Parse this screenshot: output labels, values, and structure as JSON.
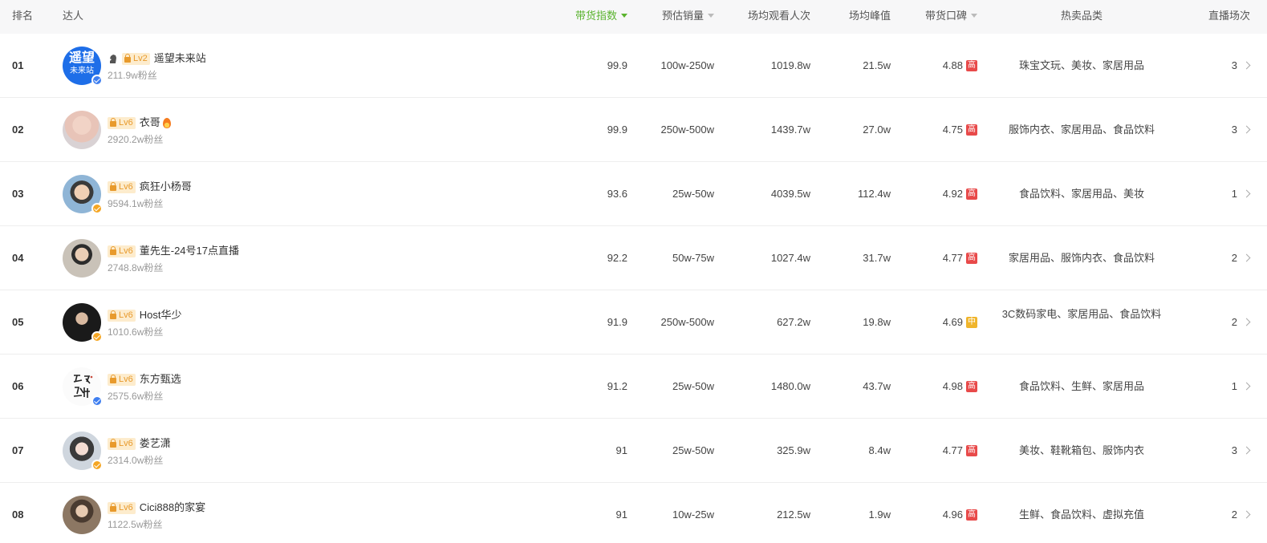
{
  "header": {
    "rank": "排名",
    "influencer": "达人",
    "score": "带货指数",
    "sales": "预估销量",
    "viewers": "场均观看人次",
    "peak": "场均峰值",
    "rating": "带货口碑",
    "categories": "热卖品类",
    "streams": "直播场次",
    "active_sort_color": "#5ab32e"
  },
  "rows": [
    {
      "rank": "01",
      "name": "遥望未来站",
      "level": "Lv2",
      "fans": "211.9w粉丝",
      "score": "99.9",
      "sales": "100w-250w",
      "viewers": "1019.8w",
      "peak": "21.5w",
      "rating": "4.88",
      "rating_badge": "高",
      "categories": "珠宝文玩、美妆、家居用品",
      "streams": "3",
      "avatar_text_1": "遥望",
      "avatar_text_2": "未来站"
    },
    {
      "rank": "02",
      "name": "衣哥",
      "level": "Lv6",
      "fans": "2920.2w粉丝",
      "score": "99.9",
      "sales": "250w-500w",
      "viewers": "1439.7w",
      "peak": "27.0w",
      "rating": "4.75",
      "rating_badge": "高",
      "categories": "服饰内衣、家居用品、食品饮料",
      "streams": "3"
    },
    {
      "rank": "03",
      "name": "疯狂小杨哥",
      "level": "Lv6",
      "fans": "9594.1w粉丝",
      "score": "93.6",
      "sales": "25w-50w",
      "viewers": "4039.5w",
      "peak": "112.4w",
      "rating": "4.92",
      "rating_badge": "高",
      "categories": "食品饮料、家居用品、美妆",
      "streams": "1"
    },
    {
      "rank": "04",
      "name": "董先生-24号17点直播",
      "level": "Lv6",
      "fans": "2748.8w粉丝",
      "score": "92.2",
      "sales": "50w-75w",
      "viewers": "1027.4w",
      "peak": "31.7w",
      "rating": "4.77",
      "rating_badge": "高",
      "categories": "家居用品、服饰内衣、食品饮料",
      "streams": "2"
    },
    {
      "rank": "05",
      "name": "Host华少",
      "level": "Lv6",
      "fans": "1010.6w粉丝",
      "score": "91.9",
      "sales": "250w-500w",
      "viewers": "627.2w",
      "peak": "19.8w",
      "rating": "4.69",
      "rating_badge": "中",
      "categories": "3C数码家电、家居用品、食品饮料",
      "streams": "2"
    },
    {
      "rank": "06",
      "name": "东方甄选",
      "level": "Lv6",
      "fans": "2575.6w粉丝",
      "score": "91.2",
      "sales": "25w-50w",
      "viewers": "1480.0w",
      "peak": "43.7w",
      "rating": "4.98",
      "rating_badge": "高",
      "categories": "食品饮料、生鲜、家居用品",
      "streams": "1"
    },
    {
      "rank": "07",
      "name": "娄艺潇",
      "level": "Lv6",
      "fans": "2314.0w粉丝",
      "score": "91",
      "sales": "25w-50w",
      "viewers": "325.9w",
      "peak": "8.4w",
      "rating": "4.77",
      "rating_badge": "高",
      "categories": "美妆、鞋靴箱包、服饰内衣",
      "streams": "3"
    },
    {
      "rank": "08",
      "name": "Cici888的家宴",
      "level": "Lv6",
      "fans": "1122.5w粉丝",
      "score": "91",
      "sales": "10w-25w",
      "viewers": "212.5w",
      "peak": "1.9w",
      "rating": "4.96",
      "rating_badge": "高",
      "categories": "生鲜、食品饮料、虚拟充值",
      "streams": "2"
    }
  ]
}
